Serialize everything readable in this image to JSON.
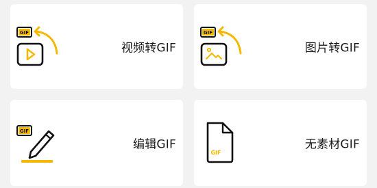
{
  "cards": [
    {
      "label": "视频转GIF",
      "icon": "video-to-gif-icon"
    },
    {
      "label": "图片转GIF",
      "icon": "image-to-gif-icon"
    },
    {
      "label": "编辑GIF",
      "icon": "edit-gif-icon"
    },
    {
      "label": "无素材GIF",
      "icon": "blank-gif-icon"
    }
  ],
  "icon_text": "GIF",
  "colors": {
    "accent": "#f5b800",
    "ink": "#111111",
    "card": "#ffffff",
    "background": "#f2f2f2"
  }
}
